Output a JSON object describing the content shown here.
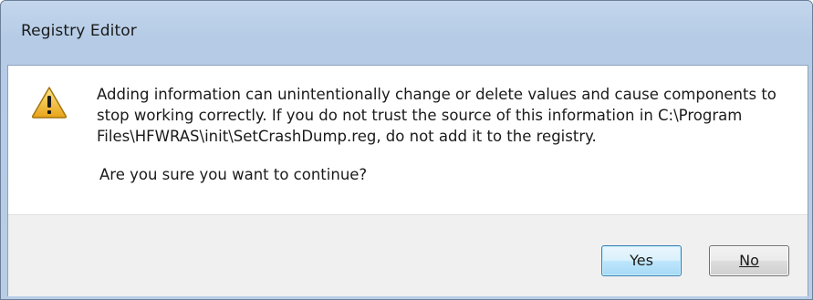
{
  "window": {
    "title": "Registry Editor"
  },
  "dialog": {
    "icon": "warning-icon",
    "message": "Adding information can unintentionally change or delete values and cause components to stop working correctly. If you do not trust the source of this information in C:\\Program Files\\HFWRAS\\init\\SetCrashDump.reg, do not add it to the registry.",
    "question": "Are you sure you want to continue?"
  },
  "buttons": {
    "yes_label": "Yes",
    "no_label": "No"
  },
  "colors": {
    "frame": "#b8cde6",
    "footer": "#f0f0f0",
    "default_button_border": "#3c7fb1",
    "warning_fill": "#f4c430"
  }
}
